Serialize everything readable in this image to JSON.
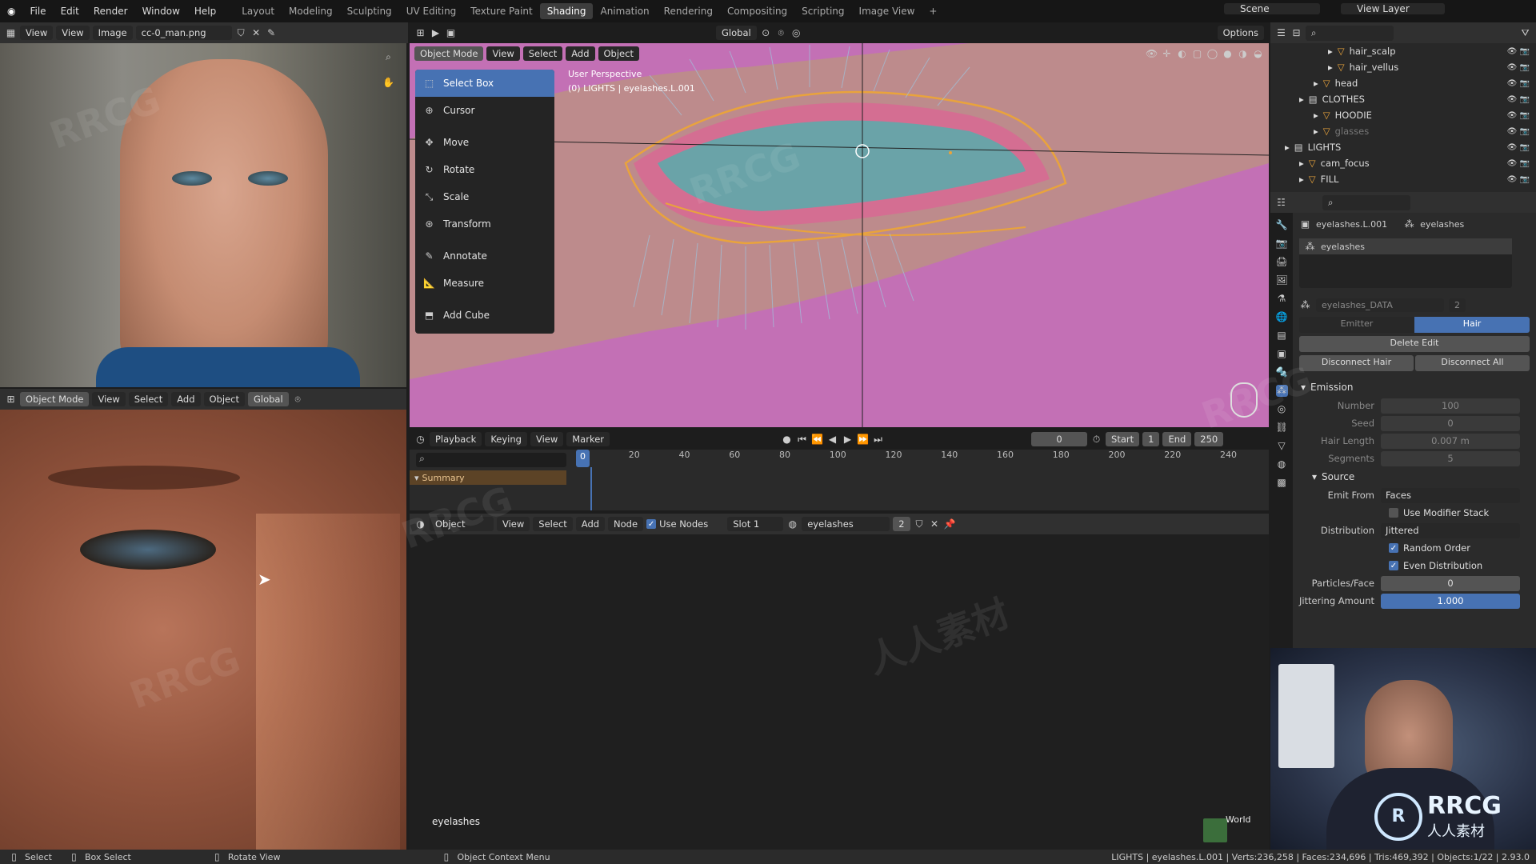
{
  "menubar": {
    "items": [
      "File",
      "Edit",
      "Render",
      "Window",
      "Help"
    ],
    "workspaces": [
      "Layout",
      "Modeling",
      "Sculpting",
      "UV Editing",
      "Texture Paint",
      "Shading",
      "Animation",
      "Rendering",
      "Compositing",
      "Scripting",
      "Image View"
    ],
    "active_workspace": "Shading",
    "scene": "Scene",
    "view_layer": "View Layer"
  },
  "image_editor": {
    "menus": [
      "View",
      "Image"
    ],
    "image_name": "cc-0_man.png"
  },
  "viewport_small": {
    "mode": "Object Mode",
    "menus": [
      "View",
      "Select",
      "Add",
      "Object"
    ],
    "orientation": "Global"
  },
  "viewport_main": {
    "mode": "Object Mode",
    "menus": [
      "View",
      "Select",
      "Add",
      "Object"
    ],
    "orientation": "Global",
    "options": "Options",
    "overlay_title": "User Perspective",
    "overlay_sub": "(0) LIGHTS | eyelashes.L.001"
  },
  "toolbar": {
    "items": [
      {
        "label": "Select Box",
        "icon": "select-box-icon",
        "active": true
      },
      {
        "label": "Cursor",
        "icon": "cursor-icon"
      },
      {
        "label": "Move",
        "icon": "move-icon"
      },
      {
        "label": "Rotate",
        "icon": "rotate-icon"
      },
      {
        "label": "Scale",
        "icon": "scale-icon"
      },
      {
        "label": "Transform",
        "icon": "transform-icon"
      },
      {
        "label": "Annotate",
        "icon": "annotate-icon"
      },
      {
        "label": "Measure",
        "icon": "measure-icon"
      },
      {
        "label": "Add Cube",
        "icon": "add-cube-icon"
      }
    ]
  },
  "timeline": {
    "menus": [
      "Playback",
      "Keying",
      "View",
      "Marker"
    ],
    "current_frame": "0",
    "start_label": "Start",
    "start": "1",
    "end_label": "End",
    "end": "250",
    "ticks": [
      "0",
      "20",
      "40",
      "60",
      "80",
      "100",
      "120",
      "140",
      "160",
      "180",
      "200",
      "220",
      "240"
    ],
    "summary": "Summary"
  },
  "node_editor": {
    "type": "Object",
    "menus": [
      "View",
      "Select",
      "Add",
      "Node"
    ],
    "use_nodes": "Use Nodes",
    "slot": "Slot 1",
    "material": "eyelashes",
    "users": "2",
    "bottom_label": "eyelashes",
    "world_label": "World"
  },
  "outliner": {
    "rows": [
      {
        "name": "hair_scalp",
        "indent": 4
      },
      {
        "name": "hair_vellus",
        "indent": 4
      },
      {
        "name": "head",
        "indent": 3
      },
      {
        "name": "CLOTHES",
        "indent": 2,
        "collection": true
      },
      {
        "name": "HOODIE",
        "indent": 3
      },
      {
        "name": "glasses",
        "indent": 3,
        "dim": true
      },
      {
        "name": "LIGHTS",
        "indent": 1,
        "collection": true
      },
      {
        "name": "cam_focus",
        "indent": 2
      },
      {
        "name": "FILL",
        "indent": 2
      }
    ]
  },
  "properties": {
    "object": "eyelashes.L.001",
    "psys": "eyelashes",
    "slot_name": "eyelashes",
    "data_name": "eyelashes_DATA",
    "data_users": "2",
    "type_emitter": "Emitter",
    "type_hair": "Hair",
    "delete_edit": "Delete Edit",
    "disconnect_hair": "Disconnect Hair",
    "disconnect_all": "Disconnect All",
    "emission": "Emission",
    "emission_rows": [
      {
        "label": "Number",
        "value": "100"
      },
      {
        "label": "Seed",
        "value": "0"
      },
      {
        "label": "Hair Length",
        "value": "0.007 m"
      },
      {
        "label": "Segments",
        "value": "5"
      }
    ],
    "source": "Source",
    "emit_from_label": "Emit From",
    "emit_from": "Faces",
    "use_modifier_stack": "Use Modifier Stack",
    "distribution_label": "Distribution",
    "distribution": "Jittered",
    "random_order": "Random Order",
    "even_distribution": "Even Distribution",
    "particles_face_label": "Particles/Face",
    "particles_face": "0",
    "jitter_label": "Jittering Amount",
    "jitter": "1.000"
  },
  "statusbar": {
    "select": "Select",
    "box_select": "Box Select",
    "rotate_view": "Rotate View",
    "context_menu": "Object Context Menu",
    "stats": "LIGHTS | eyelashes.L.001 | Verts:236,258 | Faces:234,696 | Tris:469,392 | Objects:1/22 | 2.93.0"
  },
  "watermark": {
    "text": "RRCG",
    "text2": "人人素材"
  },
  "colors": {
    "accent": "#4772b3",
    "selection": "#e9a33c",
    "viewport_pink": "#c76bb8",
    "eye_teal": "#6aa3a8"
  }
}
